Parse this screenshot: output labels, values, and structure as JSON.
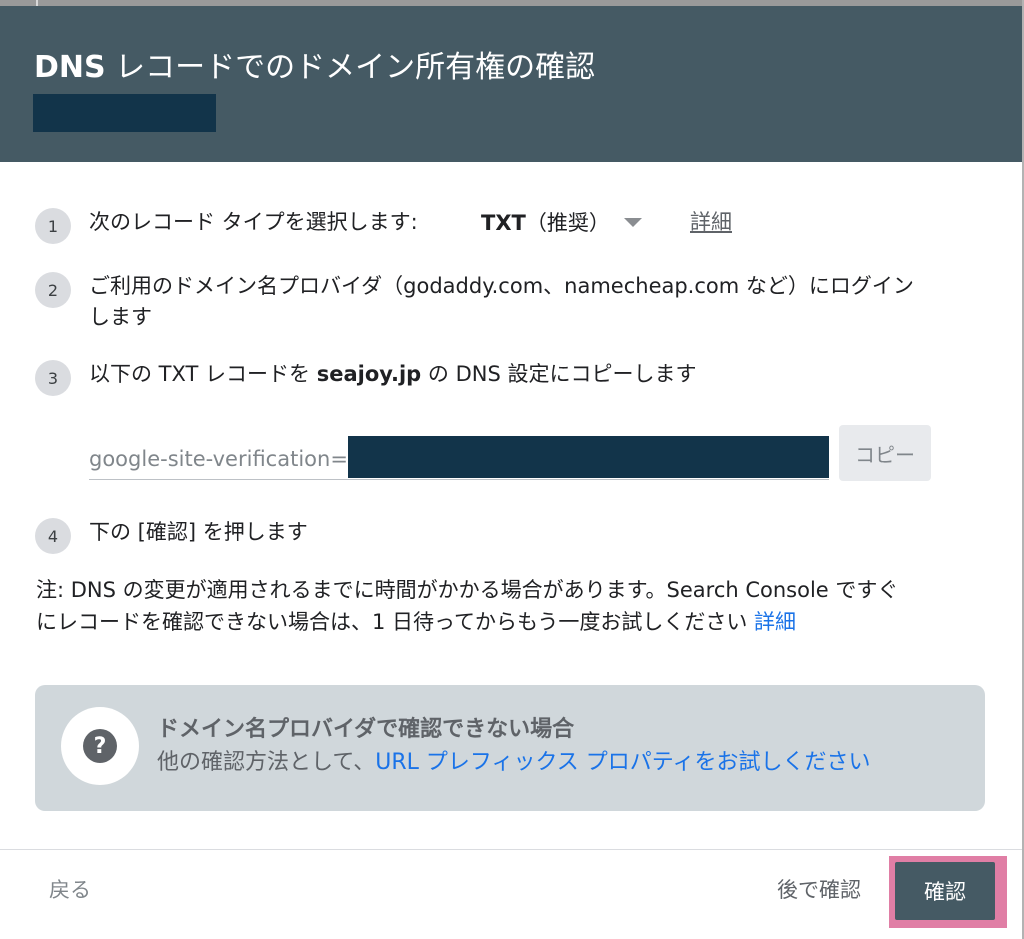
{
  "dialog": {
    "title_bold": "DNS",
    "title_rest": " レコードでのドメイン所有権の確認"
  },
  "steps": [
    {
      "number": "1",
      "text": "次のレコード タイプを選択します:"
    },
    {
      "number": "2",
      "line1": "ご利用のドメイン名プロバイダ（godaddy.com、namecheap.com など）にログイン",
      "line2": "します"
    },
    {
      "number": "3",
      "before": "以下の TXT レコードを ",
      "domain": "seajoy.jp",
      "after": " の DNS 設定にコピーします"
    },
    {
      "number": "4",
      "text": "下の [確認] を押します"
    }
  ],
  "record_type": {
    "value": "TXT",
    "suffix": "（推奨）",
    "detail_link": "詳細"
  },
  "verification": {
    "prefix": "google-site-verification=",
    "copy_label": "コピー"
  },
  "note": {
    "line1": "注: DNS の変更が適用されるまでに時間がかかる場合があります。Search Console ですぐ",
    "line2": "にレコードを確認できない場合は、1 日待ってからもう一度お試しください ",
    "link": "詳細"
  },
  "help": {
    "icon": "question-icon",
    "title": "ドメイン名プロバイダで確認できない場合",
    "desc_prefix": "他の確認方法として、",
    "desc_link": "URL プレフィックス プロパティをお試しください"
  },
  "footer": {
    "back_label": "戻る",
    "later_label": "後で確認",
    "verify_label": "確認"
  },
  "colors": {
    "header": "#455a64",
    "link": "#1a73e8",
    "redaction": "#12344a",
    "highlight": "#e07ea5"
  }
}
